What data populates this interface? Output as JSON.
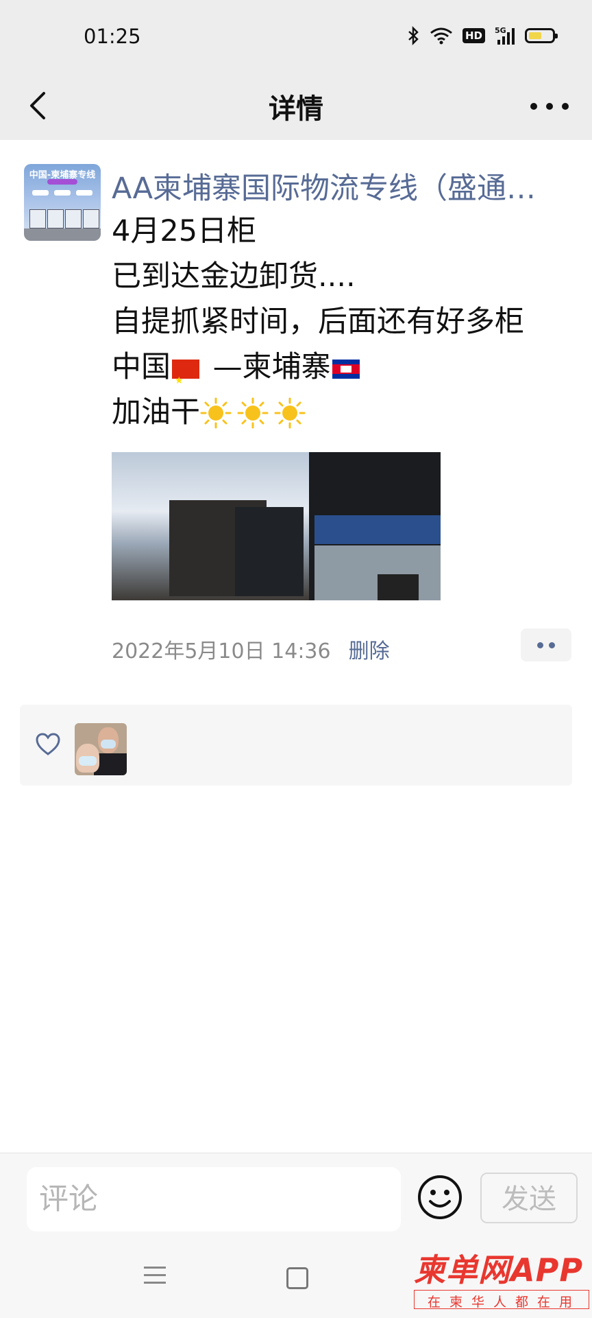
{
  "status_bar": {
    "time": "01:25",
    "icons": [
      "bluetooth-icon",
      "wifi-icon",
      "hd-icon",
      "5g-signal-icon",
      "battery-icon"
    ],
    "hd_label": "HD",
    "network_label": "5G"
  },
  "nav": {
    "title": "详情",
    "back_icon": "chevron-left-icon",
    "more_icon": "more-dots-icon"
  },
  "post": {
    "avatar_caption": "中国-柬埔寨专线",
    "author": "AA柬埔寨国际物流专线（盛通…",
    "lines": {
      "line1": "4月25日柜",
      "line2": "已到达金边卸货....",
      "line3": "自提抓紧时间，后面还有好多柜",
      "line4_a": "中国",
      "line4_b": " —柬埔寨",
      "line5": "加油干"
    },
    "emoji_icons": [
      "china-flag-icon",
      "cambodia-flag-icon",
      "sun-icon",
      "sun-icon",
      "sun-icon"
    ],
    "timestamp": "2022年5月10日 14:36",
    "delete_label": "删除"
  },
  "likes": {
    "icon": "heart-icon",
    "count_avatars": 1
  },
  "comment_bar": {
    "placeholder": "评论",
    "emoji_icon": "emoji-face-icon",
    "send_label": "发送"
  },
  "watermark": {
    "main": "柬单网APP",
    "sub": "在柬华人都在用"
  },
  "colors": {
    "link": "#576b95",
    "header_bg": "#ededed",
    "watermark": "#e8372f"
  }
}
